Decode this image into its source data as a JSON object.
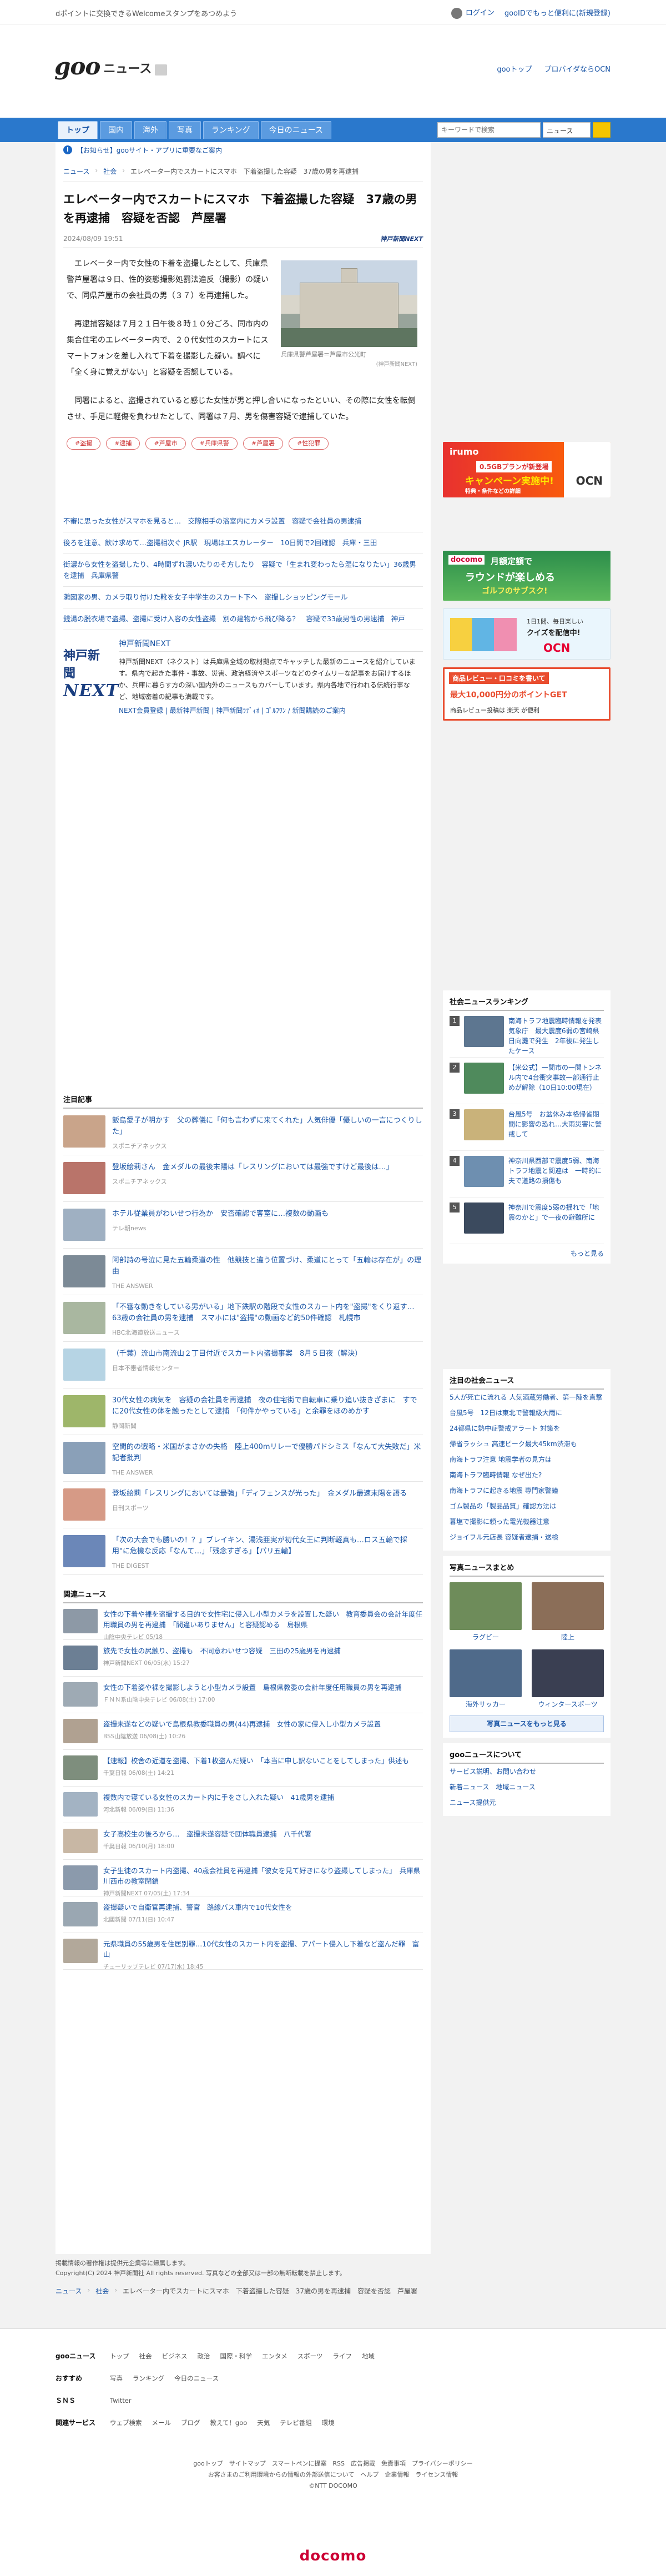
{
  "topbar": {
    "promo": "dポイントに交換できるWelcomeスタンプをあつめよう",
    "login": "ログイン",
    "goo_id": "gooIDでもっと便利に(新規登録)"
  },
  "header": {
    "logo_goo": "goo",
    "logo_news": "ニュース",
    "link_top": "gooトップ",
    "link_provider": "プロバイダならOCN"
  },
  "nav": {
    "tabs": [
      "トップ",
      "国内",
      "海外",
      "写真",
      "ランキング",
      "今日のニュース"
    ],
    "search_placeholder": "キーワードで検索",
    "search_scope": "ニュース"
  },
  "notice": "【お知らせ】gooサイト・アプリに重要なご案内",
  "breadcrumb": [
    "ニュース",
    "社会",
    "エレベーター内でスカートにスマホ　下着盗撮した容疑　37歳の男を再逮捕"
  ],
  "article": {
    "title": "エレベーター内でスカートにスマホ　下着盗撮した容疑　37歳の男を再逮捕　容疑を否認　芦屋署",
    "date": "2024/08/09 19:51",
    "source_logo": "神戸新聞NEXT",
    "photo_caption": "兵庫県警芦屋署＝芦屋市公光町",
    "photo_credit": "(神戸新聞NEXT)",
    "p1": "エレベーター内で女性の下着を盗撮したとして、兵庫県警芦屋署は９日、性的姿態撮影処罰法違反（撮影）の疑いで、同県芦屋市の会社員の男（３７）を再逮捕した。",
    "p2": "再逮捕容疑は７月２１日午後８時１０分ごろ、同市内の集合住宅のエレベーター内で、２０代女性のスカートにスマートフォンを差し入れて下着を撮影した疑い。調べに「全く身に覚えがない」と容疑を否認している。",
    "p3": "同署によると、盗撮されていると感じた女性が男と押し合いになったといい、その際に女性を転倒させ、手足に軽傷を負わせたとして、同署は７月、男を傷害容疑で逮捕していた。",
    "tags": [
      "#盗撮",
      "#逮捕",
      "#芦屋市",
      "#兵庫県警",
      "#芦屋署",
      "#性犯罪"
    ]
  },
  "leadlinks": [
    "不審に思った女性がスマホを見ると…　交際相手の浴室内にカメラ設置　容疑で会社員の男逮捕",
    "後ろを注意、飲け求めて…盗撮相次ぐ JR駅　現場はエスカレーター　10日間で2回確認　兵庫・三田",
    "街濃から女性を盗撮したり、4時間ずれ濃いたりのそ方したり　容疑で「生まれ変わったら湿になりたい」36歳男を逮捕　兵庫県警",
    "灘図家の男、カメラ取り付けた靴を女子中学生のスカート下へ　盗撮しショッピングモール",
    "銭湯の脱衣場で盗撮、盗撮に受け入容の女性盗撮　別の建物から飛び降る？　容疑で33歳男性の男逮捕　神戸"
  ],
  "kobe": {
    "logo_a": "神戸新聞",
    "logo_b": "NEXT",
    "title": "神戸新聞NEXT",
    "desc": "神戸新聞NEXT（ネクスト）は兵庫県全域の取材拠点でキャッチした最新のニュースを紹介しています。県内で起きた事件・事故、災害、政治経済やスポーツなどのタイムリーな記事をお届けするほか、兵庫に暮らす方の深い国内外のニュースもカバーしています。県内各地で行われる伝統行事など、地域密着の記事も満載です。",
    "links": "NEXT会員登録 | 最新神戸新聞 | 神戸新聞ﾗﾃﾞｨｵ | ｺﾞﾙﾌﾜﾝ / 新聞購読のご案内"
  },
  "featured": {
    "heading": "注目記事",
    "items": [
      {
        "text": "飯島愛子が明かす　父の葬儀に「何も言わずに来てくれた」人気俳優「優しいの一言につくりした」",
        "src": "スポニチアネックス"
      },
      {
        "text": "登坂絵莉さん　金メダルの最後末陽は「レスリングにおいては最強ですけど最後は…」",
        "src": "スポニチアネックス"
      },
      {
        "text": "ホテル従業員がわいせつ行為か　安否確認で客室に…複数の動画も",
        "src": "テレ朝news"
      },
      {
        "text": "阿部詩の号泣に見た五輪柔道の性　他競技と違う位置づけ、柔道にとって「五輪は存在が」の理由",
        "src": "THE ANSWER"
      },
      {
        "text": "「不審な動きをしている男がいる」地下鉄駅の階段で女性のスカート内を\"盗撮\"をくり返す…63歳の会社員の男を逮捕　スマホには\"盗撮\"の動画など約50件確認　札幌市",
        "src": "HBC北海道放送ニュース"
      },
      {
        "text": "（千葉）流山市南流山２丁目付近でスカート内盗撮事案　8月５日夜（解決）",
        "src": "日本不審者情報センター"
      },
      {
        "text": "30代女性の病気を　容疑の会社員を再逮捕　夜の住宅街で自転車に乗り追い抜きざまに　すでに20代女性の体を触ったとして逮捕　「何件かやっている」と余罪をほのめかす",
        "src": "静岡新聞"
      },
      {
        "text": "空間的の戦略・米国がまさかの失格　陸上400mリレーで優勝パドシミス「なんて大失敗だ」米記者批判",
        "src": "THE ANSWER"
      },
      {
        "text": "登坂絵莉「レスリングにおいては最強」「ディフェンスが光った」　金メダル最速末陽を語る",
        "src": "日刊スポーツ"
      },
      {
        "text": "「次の大会でも勝いの！？」ブレイキン、湯浅亜実が初代女王に判断軽真も…ロス五輪で採用\"に危機な反応「なんて…」「残念すぎる」【パリ五輪】",
        "src": "THE DIGEST"
      }
    ]
  },
  "related": {
    "heading": "関連ニュース",
    "items": [
      {
        "text": "女性の下着や裸を盗撮する目的で女性宅に侵入し小型カメラを設置した疑い　教育委員会の会計年度任用職員の男を再逮捕　「間違いありません」と容疑認める　島根県",
        "src": "山陰中央テレビ 05/18"
      },
      {
        "text": "旅先で女性の尻触り、盗撮も　不同意わいせつ容疑　三田の25歳男を再逮捕",
        "src": "神戸新聞NEXT 06/05(水) 15:27"
      },
      {
        "text": "女性の下着姿や裸を撮影しようと小型カメラ設置　島根県教委の会計年度任用職員の男を再逮捕",
        "src": "ＦＮＮ系山陰中央テレビ 06/08(土) 17:00"
      },
      {
        "text": "盗撮未遂などの疑いで島根県教委職員の男(44)再逮捕　女性の家に侵入し小型カメラ設置",
        "src": "BSS山陰放送 06/08(土) 10:26"
      },
      {
        "text": "【速報】校舎の近道を盗撮、下着1枚盗んだ疑い　「本当に申し訳ないことをしてしまった」供述も",
        "src": "千葉日報 06/08(土) 14:21"
      },
      {
        "text": "複数内で寝ている女性のスカート内に手をさし入れた疑い　41歳男を逮捕",
        "src": "河北新報 06/09(日) 11:36"
      },
      {
        "text": "女子高校生の後ろから…　盗撮未遂容疑で団体職員逮捕　八千代署",
        "src": "千葉日報 06/10(月) 18:00"
      },
      {
        "text": "女子生徒のスカート内盗撮、40歳会社員を再逮捕「彼女を見て好きになり盗撮してしまった」　兵庫県川西市の教室閉鎖",
        "src": "神戸新聞NEXT 07/05(土) 17:34"
      },
      {
        "text": "盗撮疑いで自衛官再逮捕、警官　路線バス車内で10代女性を",
        "src": "北國新聞 07/11(日) 10:47"
      },
      {
        "text": "元県職員の55歳男を住居別罪…10代女性のスカート内を盗撮、アパート侵入し下着など盗んだ罪　富山",
        "src": "チューリップテレビ 07/17(水) 18:45"
      }
    ]
  },
  "sidebar": {
    "ad1_brand": "irumo",
    "ad1_line": "0.5GBプランが新登場",
    "ad1_big": "キャンペーン実施中!",
    "ad1_sub": "特典・条件などの詳細",
    "ad1_ocn": "OCN",
    "ad2_brand": "docomo",
    "ad2_line": "月額定額で",
    "ad2_big": "ラウンドが楽しめる",
    "ad2_sub": "ゴルフのサブスク!",
    "ad3_line": "1日1問、毎日楽しい",
    "ad3_big": "クイズを配信中!",
    "ad3_ocn": "OCN",
    "ad4_line": "商品レビュー・口コミを書いて",
    "ad4_big": "最大10,000円分のポイントGET",
    "ad4_sub": "商品レビュー投稿は 楽天 が便利",
    "ranking_title": "社会ニュースランキング",
    "ranking": [
      "南海トラフ地震臨時情報を発表　気象庁　最大震度6弱の宮崎県日向灘で発生　2年後に発生したケース",
      "【米公式】一関市の一関トンネル内で4台衝突事故一部通行止めが解除（10日10:00現在）",
      "台風5号　お盆休み本格帰省期間に影響の恐れ…大雨災害に警戒して",
      "神奈川県西部で震度5弱、南海トラフ地震と関連は　一時的に夫で道路の損傷も",
      "神奈川で震度5弱の揺れで「地震のかと」で一夜の避難所に"
    ],
    "ranking_more": "もっと見る",
    "watch_title": "注目の社会ニュース",
    "watch": [
      "5人が死亡に流れる 人気酒蔵労働者、第一陣を直撃",
      "台風5号　12日は東北で警報級大雨に",
      "24都県に熱中症警戒アラート 対策を",
      "帰省ラッシュ 高速ピーク最大45km渋滞も",
      "南海トラフ注意 地震学者の見方は",
      "南海トラフ臨時情報 なぜ出た?",
      "南海トラフに起きる地震 専門家警鐘",
      "ゴム製品の「製品品質」確認方法は",
      "暮塩で撮影に頼った電光機器注意",
      "ジョイフル元店長 容疑者逮捕・送検"
    ],
    "photo_title": "写真ニュースまとめ",
    "photos": [
      "ラグビー",
      "陸上",
      "海外サッカー",
      "ウィンタースポーツ"
    ],
    "photo_more": "写真ニュースをもっと見る",
    "about_title": "gooニュースについて",
    "about": [
      "サービス説明、お問い合わせ",
      "新着ニュース　地域ニュース",
      "ニュース提供元"
    ]
  },
  "below": {
    "copyright1": "掲載情報の著作権は提供元企業等に帰属します。",
    "copyright2": "Copyright(C) 2024 神戸新聞社 All rights reserved. 写真などの全部又は一部の無断転載を禁止します。",
    "crumbs": [
      "ニュース",
      "社会",
      "エレベーター内でスカートにスマホ　下着盗撮した容疑　37歳の男を再逮捕　容疑を否認　芦屋署"
    ]
  },
  "footer": {
    "rows": [
      {
        "label": "gooニュース",
        "links": [
          "トップ",
          "社会",
          "ビジネス",
          "政治",
          "国際・科学",
          "エンタメ",
          "スポーツ",
          "ライフ",
          "地域"
        ]
      },
      {
        "label": "おすすめ",
        "links": [
          "写真",
          "ランキング",
          "今日のニュース"
        ]
      },
      {
        "label": "ＳＮＳ",
        "links": [
          "Twitter"
        ]
      },
      {
        "label": "関連サービス",
        "links": [
          "ウェブ検索",
          "メール",
          "ブログ",
          "教えて！goo",
          "天気",
          "テレビ番組",
          "環境"
        ]
      }
    ],
    "bottom1": "gooトップ　サイトマップ　スマートペンに提案　RSS　広告掲載　免責事項　プライバシーポリシー",
    "bottom2": "お客さまのご利用環境からの情報の外部送信について　ヘルプ　企業情報　ライセンス情報",
    "copyright": "©NTT DOCOMO",
    "brand": "docomo"
  }
}
